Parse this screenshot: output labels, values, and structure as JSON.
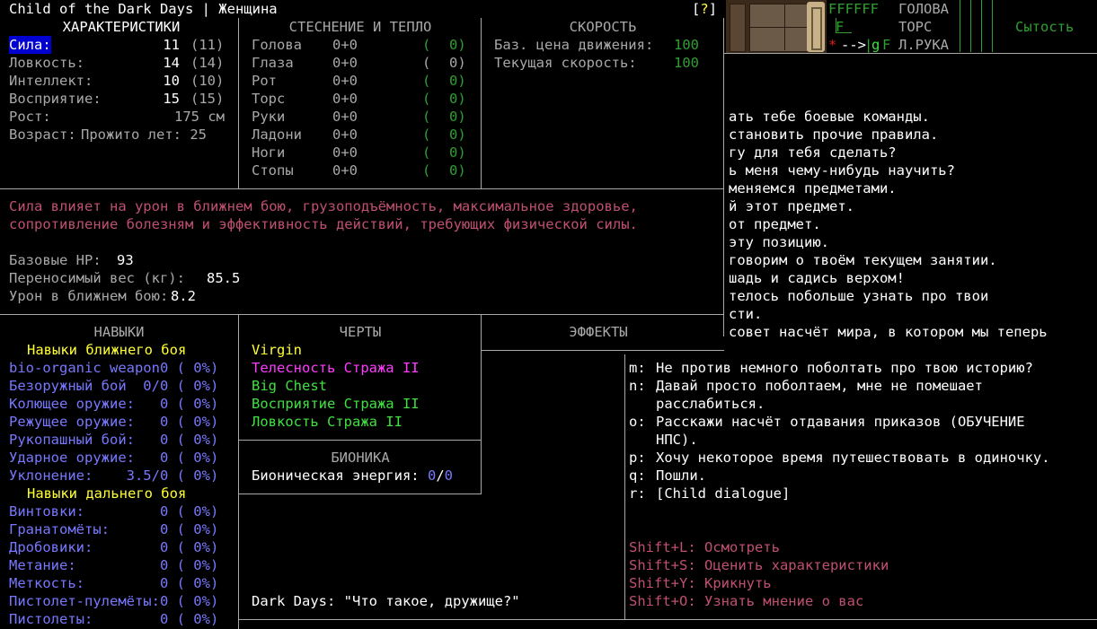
{
  "title_bar": {
    "title": "Child of the Dark Days | Женщина",
    "help": "?"
  },
  "stats": {
    "header": "ХАРАКТЕРИСТИКИ",
    "rows": [
      {
        "label": "Сила:",
        "value": "11",
        "base": "(11)"
      },
      {
        "label": "Ловкость:",
        "value": "14",
        "base": "(14)"
      },
      {
        "label": "Интеллект:",
        "value": "10",
        "base": "(10)"
      },
      {
        "label": "Восприятие:",
        "value": "15",
        "base": "(15)"
      }
    ],
    "height_label": "Рост:",
    "height_value": "175 см",
    "age_label": "Возраст:",
    "age_value": "Прожито лет: 25"
  },
  "encumbrance": {
    "header": "СТЕСНЕНИЕ И ТЕПЛО",
    "rows": [
      {
        "part": "Голова",
        "enc": "0+0",
        "open": "(",
        "warm": "0)"
      },
      {
        "part": "Глаза",
        "enc": "0+0",
        "open": "(",
        "warm": "0)"
      },
      {
        "part": "Рот",
        "enc": "0+0",
        "open": "(",
        "warm": "0)"
      },
      {
        "part": "Торс",
        "enc": "0+0",
        "open": "(",
        "warm": "0)"
      },
      {
        "part": "Руки",
        "enc": "0+0",
        "open": "(",
        "warm": "0)"
      },
      {
        "part": "Ладони",
        "enc": "0+0",
        "open": "(",
        "warm": "0)"
      },
      {
        "part": "Ноги",
        "enc": "0+0",
        "open": "(",
        "warm": "0)"
      },
      {
        "part": "Стопы",
        "enc": "0+0",
        "open": "(",
        "warm": "0)"
      }
    ]
  },
  "speed": {
    "header": "СКОРОСТЬ",
    "rows": [
      {
        "label": "Баз. цена движения:",
        "value": "100"
      },
      {
        "label": "Текущая скорость:",
        "value": "100"
      }
    ]
  },
  "sidebar": {
    "top_row": "FFFFFF",
    "f_glyph": "F",
    "star": "*",
    "arrow": "-->",
    "bar": "|",
    "g": "g",
    "f2": "F",
    "labels": [
      "ГОЛОВА",
      "ТОРС",
      "Л.РУКА"
    ],
    "hunger": "Сытость"
  },
  "description": {
    "line1": "Сила влияет на урон в ближнем бою, грузоподъёмность, максимальное здоровье,",
    "line2": "сопротивление болезням и эффективность действий, требующих физической силы.",
    "hp_label": "Базовые HP:",
    "hp_value": "93",
    "weight_label": "Переносимый вес (кг):",
    "weight_value": "85.5",
    "dmg_label": "Урон в ближнем бою:",
    "dmg_value": "8.2"
  },
  "dialogue_upper": [
    "ать тебе боевые команды.",
    "становить прочие правила.",
    "гу для тебя сделать?",
    "ь меня чему-нибудь научить?",
    "меняемся предметами.",
    "й этот предмет.",
    "от предмет.",
    "эту позицию.",
    "говорим о твоём текущем занятии.",
    "шадь и садись верхом!",
    "телось побольше узнать про твои",
    "сти.",
    "совет насчёт мира, в котором мы теперь"
  ],
  "dialogue_lower": [
    {
      "key": "m:",
      "text": "Не против немного поболтать про твою историю?"
    },
    {
      "key": "n:",
      "text": "Давай просто поболтаем, мне не помешает"
    },
    {
      "key": "",
      "text": "расслабиться."
    },
    {
      "key": "o:",
      "text": "Расскажи насчёт отдавания приказов (ОБУЧЕНИЕ"
    },
    {
      "key": "",
      "text": "НПС)."
    },
    {
      "key": "p:",
      "text": "Хочу некоторое время путешествовать в одиночку."
    },
    {
      "key": "q:",
      "text": "Пошли."
    },
    {
      "key": "r:",
      "text": "[Child dialogue]"
    }
  ],
  "dialogue_actions": [
    "Shift+L: Осмотреть",
    "Shift+S: Оценить характеристики",
    "Shift+Y: Крикнуть",
    "Shift+O: Узнать мнение о вас"
  ],
  "npc_says": "Dark Days: \"Что такое, дружище?\"",
  "skills": {
    "header": "НАВЫКИ",
    "melee_header": "Навыки ближнего боя",
    "melee": [
      "bio-organic weapon0 ( 0%)",
      "Безоружный бой  0/0 ( 0%)",
      "Колющее оружие:   0 ( 0%)",
      "Режущее оружие:   0 ( 0%)",
      "Рукопашный бой:   0 ( 0%)",
      "Ударное оружие:   0 ( 0%)",
      "Уклонение:    3.5/0 ( 0%)"
    ],
    "ranged_header": "Навыки дальнего боя",
    "ranged": [
      "Винтовки:         0 ( 0%)",
      "Гранатомёты:      0 ( 0%)",
      "Дробовики:        0 ( 0%)",
      "Метание:          0 ( 0%)",
      "Меткость:         0 ( 0%)",
      "Пистолет-пулемёты:0 ( 0%)",
      "Пистолеты:        0 ( 0%)"
    ]
  },
  "traits": {
    "header": "ЧЕРТЫ",
    "items": [
      "Virgin",
      "Телесность Стража II",
      "Big Chest",
      "Восприятие Стража II",
      "Ловкость Стража II"
    ]
  },
  "effects": {
    "header": "ЭФФЕКТЫ"
  },
  "bionics": {
    "header": "БИОНИКА",
    "label": "Бионическая энергия:",
    "current": "0",
    "sep": "/",
    "max": "0"
  },
  "colors": {
    "highlight_bg": "#0000d0",
    "yellow": "#ffff30",
    "blue": "#7878ff",
    "magenta": "#ff3cff",
    "green": "#40e040",
    "dark_green": "#2fa02f",
    "pink": "#c05070"
  }
}
